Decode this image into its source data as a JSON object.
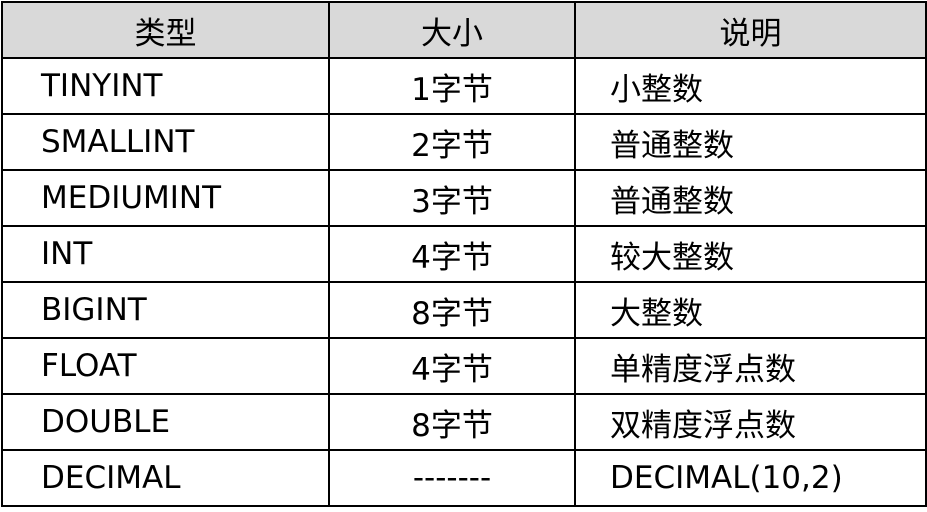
{
  "header": {
    "type": "类型",
    "size": "大小",
    "desc": "说明"
  },
  "rows": [
    {
      "type": "TINYINT",
      "size": "1字节",
      "desc": "小整数"
    },
    {
      "type": "SMALLINT",
      "size": "2字节",
      "desc": "普通整数"
    },
    {
      "type": "MEDIUMINT",
      "size": "3字节",
      "desc": "普通整数"
    },
    {
      "type": "INT",
      "size": "4字节",
      "desc": "较大整数"
    },
    {
      "type": "BIGINT",
      "size": "8字节",
      "desc": "大整数"
    },
    {
      "type": "FLOAT",
      "size": "4字节",
      "desc": "单精度浮点数"
    },
    {
      "type": "DOUBLE",
      "size": "8字节",
      "desc": "双精度浮点数"
    },
    {
      "type": "DECIMAL",
      "size": "-------",
      "desc": "DECIMAL(10,2)"
    }
  ],
  "colors": {
    "header_bg": "#d9d9d9",
    "border": "#000000",
    "text": "#000000"
  }
}
